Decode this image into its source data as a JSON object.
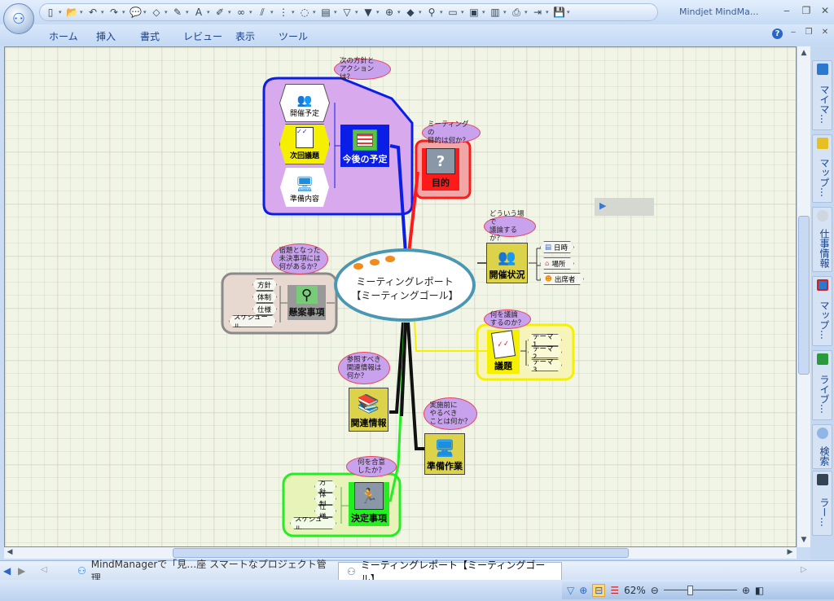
{
  "app": {
    "title": "Mindjet MindMa...",
    "orb_icon": "mindmap-logo-icon"
  },
  "qat": {
    "icons": [
      "new-icon",
      "open-icon",
      "undo-icon",
      "redo-icon",
      "callout-icon",
      "fill-icon",
      "line-icon",
      "font-icon",
      "format-painter-icon",
      "link-icon",
      "attachment-icon",
      "relationship-icon",
      "boundary-icon",
      "notes-icon",
      "filter-icon",
      "filter-off-icon",
      "add-topic-icon",
      "marker-icon",
      "hierarchy-icon",
      "layout-icon",
      "view-icon",
      "outline-icon",
      "print-icon",
      "export-icon",
      "save-icon"
    ]
  },
  "ribbon": {
    "tabs": [
      "ホーム",
      "挿入",
      "書式",
      "レビュー",
      "表示",
      "ツール"
    ]
  },
  "map": {
    "central": {
      "line1": "ミーティングレポート",
      "line2": "【ミーティングゴール】"
    },
    "topics": {
      "schedule": {
        "label": "今後の予定",
        "callout": [
          "次の方針と",
          "アクションは？"
        ],
        "children": [
          "開催予定",
          "次回議題",
          "準備内容"
        ]
      },
      "purpose": {
        "label": "目的",
        "callout": [
          "ミーティングの",
          "目的は何か？"
        ]
      },
      "status": {
        "label": "開催状況",
        "callout": [
          "どういう場で",
          "議論するか？"
        ],
        "children": [
          "日時",
          "場所",
          "出席者"
        ]
      },
      "pending": {
        "label": "懸案事項",
        "callout": [
          "宿題となった",
          "未決事項には",
          "何があるか？"
        ],
        "children": [
          "方針",
          "体制",
          "仕様",
          "スケジュール"
        ]
      },
      "agenda": {
        "label": "議題",
        "callout": [
          "何を議論",
          "するのか？"
        ],
        "children": [
          "テーマ1",
          "テーマ2",
          "テーマ3"
        ]
      },
      "related": {
        "label": "関連情報",
        "callout": [
          "参照すべき",
          "関連情報は",
          "何か？"
        ]
      },
      "prep": {
        "label": "準備作業",
        "callout": [
          "実施前に",
          "やるべき",
          "ことは何か？"
        ]
      },
      "decided": {
        "label": "決定事項",
        "callout": [
          "何を合意",
          "したか？"
        ],
        "children": [
          "方針",
          "体制",
          "仕様",
          "スケジュール"
        ]
      }
    },
    "colors": {
      "schedule": "#0a1ee8",
      "purpose": "#ff1a1a",
      "status": "#222222",
      "pending": "#8a8a8a",
      "agenda": "#f5f000",
      "related": "#111111",
      "prep": "#111111",
      "decided": "#22ee22",
      "central_border": "#4a97b4"
    }
  },
  "right_pane": {
    "tabs": [
      "マイマ…",
      "マップ…",
      "仕事情報",
      "マップ…",
      "ライブ…",
      "検索",
      "ラー…"
    ]
  },
  "doc_tabs": [
    {
      "label": "MindManagerで「見…座 スマートなプロジェクト管理",
      "active": false
    },
    {
      "label": "ミーティングレポート【ミーティングゴール】",
      "active": true
    }
  ],
  "status": {
    "zoom": "62%",
    "zoom_fraction": 0.35
  }
}
